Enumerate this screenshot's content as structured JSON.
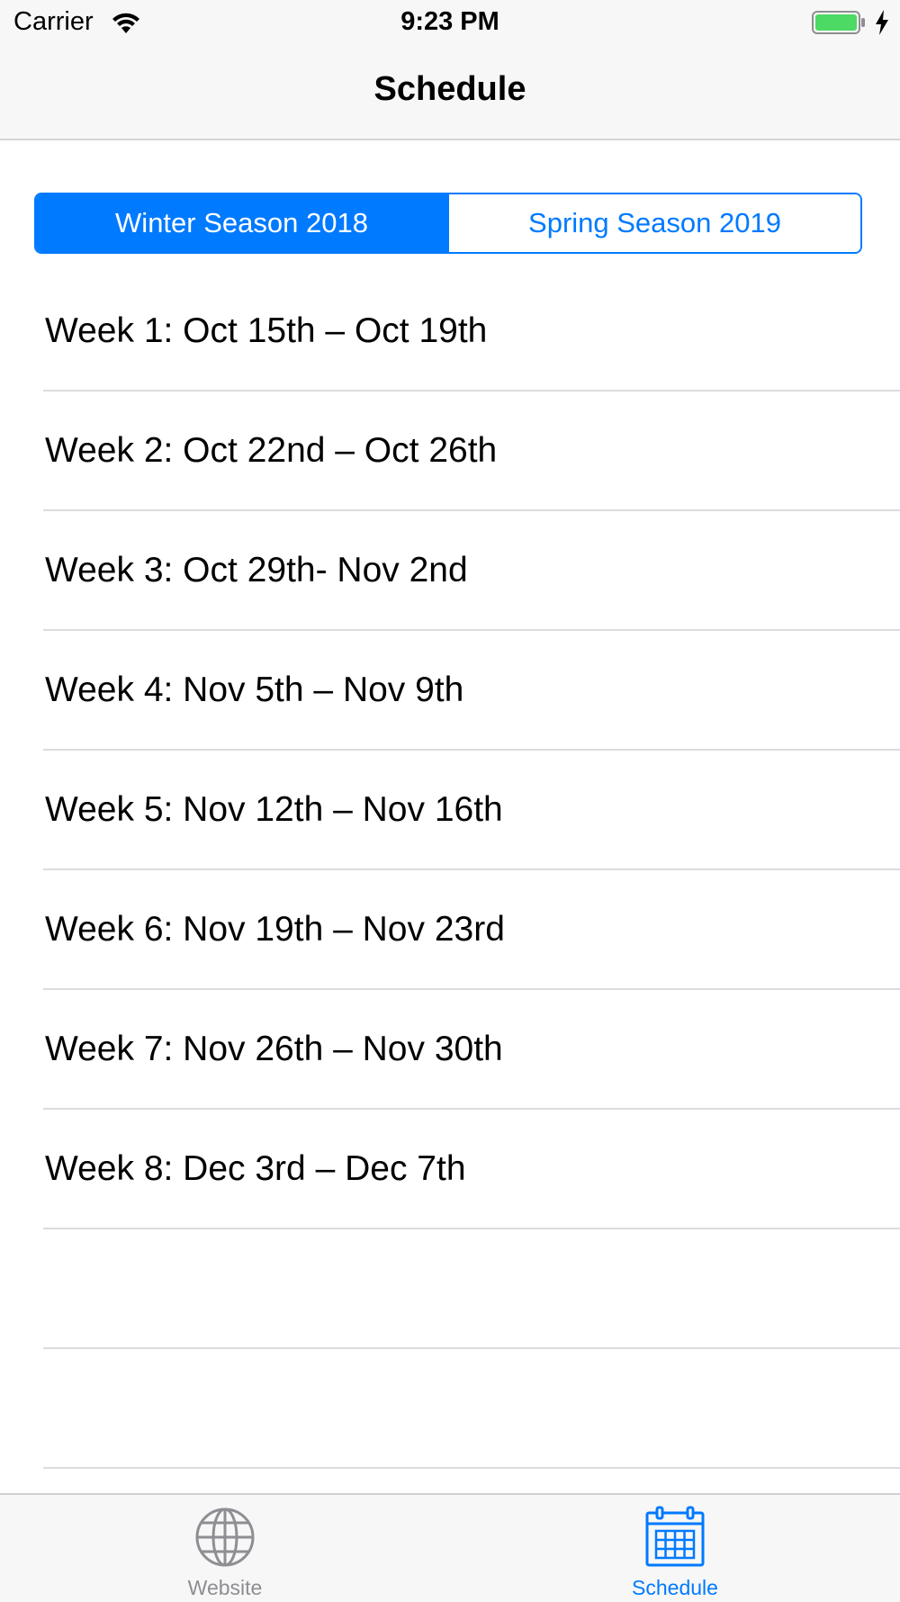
{
  "status_bar": {
    "carrier": "Carrier",
    "time": "9:23 PM"
  },
  "nav": {
    "title": "Schedule"
  },
  "segmented": {
    "options": [
      "Winter Season 2018",
      "Spring Season 2019"
    ],
    "selected_index": 0
  },
  "weeks": [
    "Week 1: Oct 15th – Oct 19th",
    "Week 2: Oct 22nd – Oct 26th",
    "Week 3: Oct 29th- Nov 2nd",
    "Week 4: Nov 5th – Nov 9th",
    "Week 5: Nov 12th – Nov 16th",
    "Week 6: Nov 19th – Nov 23rd",
    "Week 7: Nov 26th – Nov 30th",
    "Week 8: Dec 3rd – Dec 7th"
  ],
  "tab_bar": {
    "tabs": [
      {
        "label": "Website",
        "icon": "globe-icon",
        "active": false
      },
      {
        "label": "Schedule",
        "icon": "calendar-icon",
        "active": true
      }
    ]
  },
  "colors": {
    "accent": "#007aff",
    "inactive": "#8e8e93",
    "battery": "#4cd964"
  }
}
